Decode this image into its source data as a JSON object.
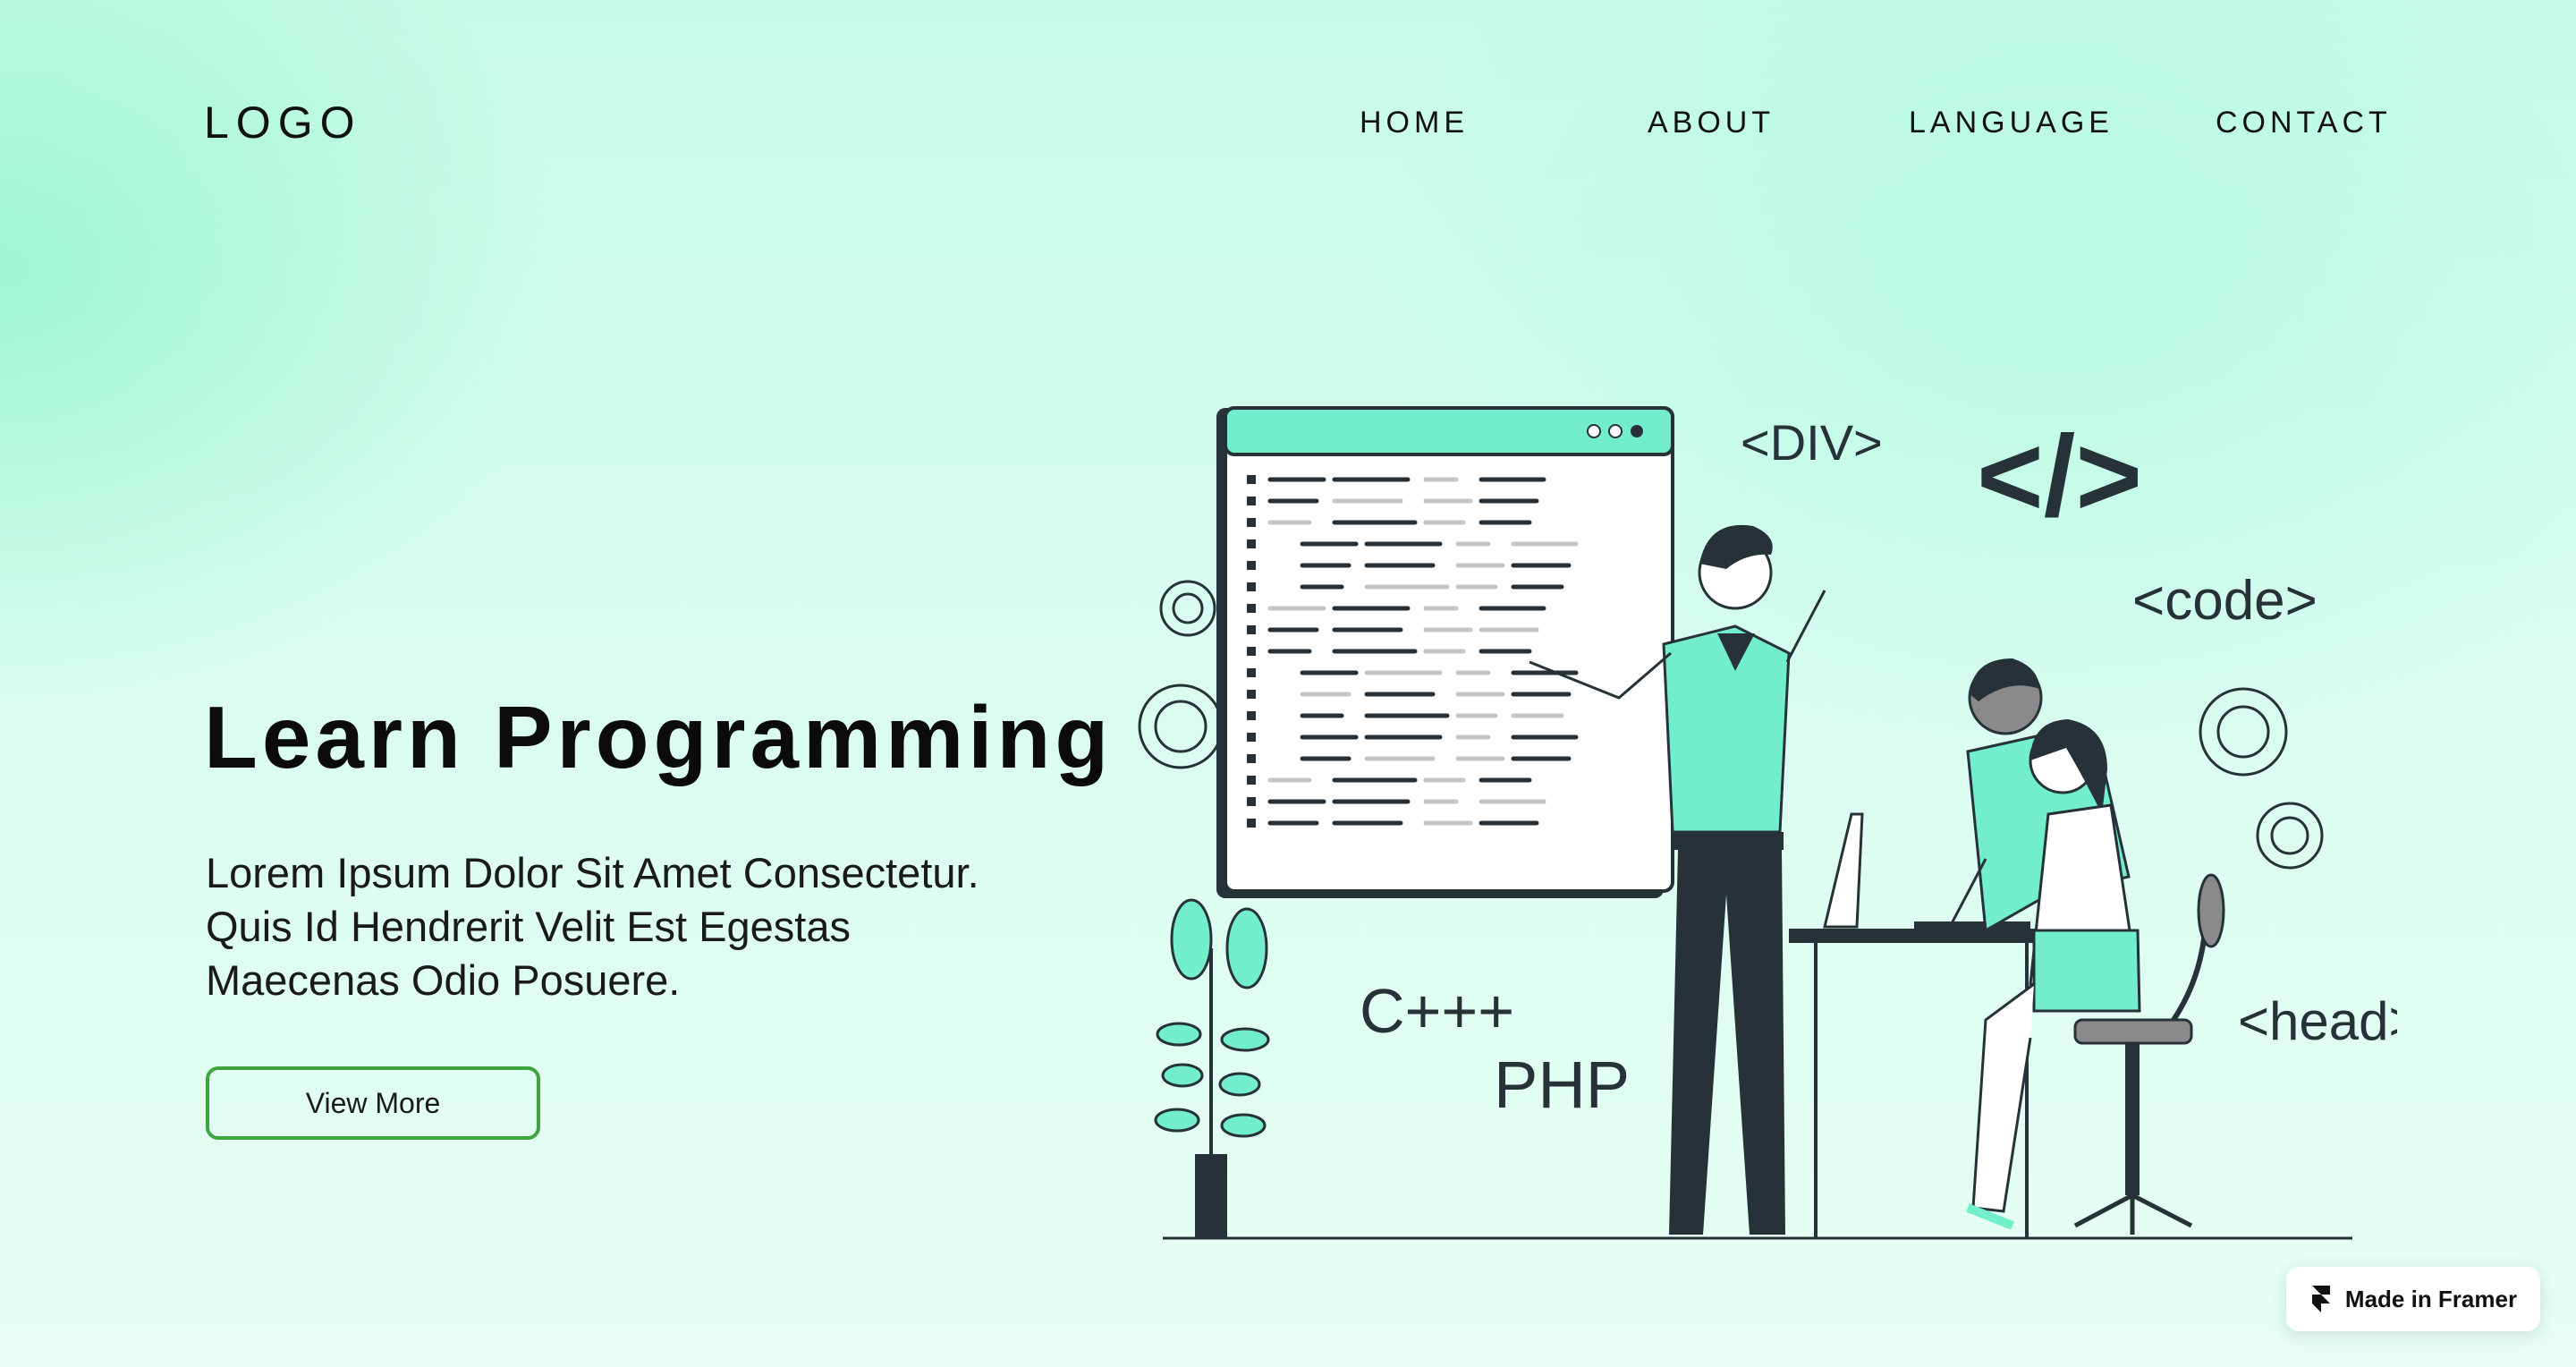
{
  "header": {
    "logo": "LOGO",
    "nav": [
      "HOME",
      "ABOUT",
      "LANGUAGE",
      "CONTACT"
    ]
  },
  "hero": {
    "title": "Learn Programming",
    "lines": [
      "Lorem Ipsum Dolor Sit Amet Consectetur.",
      "Quis Id Hendrerit Velit Est Egestas",
      "Maecenas Odio Posuere."
    ],
    "button_label": "View More"
  },
  "illustration": {
    "tags": {
      "div": "<DIV>",
      "slash": "</>",
      "code": "<code>",
      "cpp": "C+++",
      "php": "PHP",
      "head": "<head>"
    }
  },
  "badge": {
    "label": "Made in Framer",
    "icon": "framer-icon"
  },
  "colors": {
    "accent": "#72eecb",
    "dark": "#263238",
    "button_border": "#3ea43d"
  }
}
